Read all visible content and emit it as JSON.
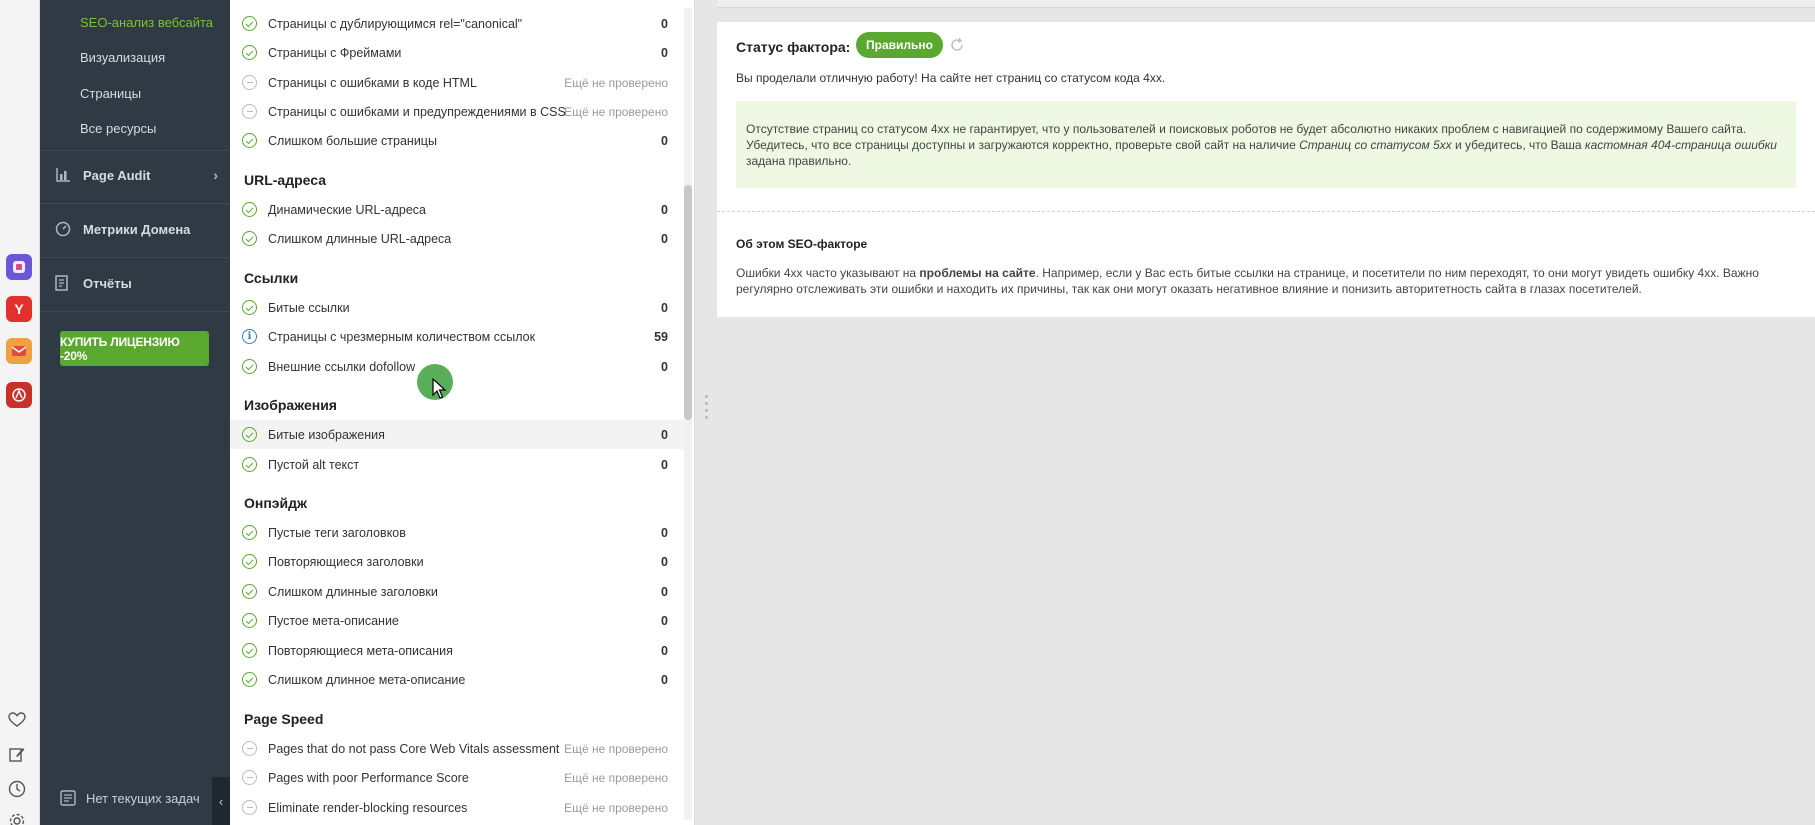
{
  "dock": {
    "apps": [
      {
        "icon": "figma-like-app-icon",
        "color": "#6b56d8"
      },
      {
        "icon": "yandex-browser-icon",
        "color": "#e2302d",
        "glyph": "Y"
      },
      {
        "icon": "mail-app-icon",
        "color": "#f0a040"
      },
      {
        "icon": "red-app-icon",
        "color": "#c8312a"
      }
    ]
  },
  "sidebar": {
    "sub_items": [
      "SEO-анализ вебсайта",
      "Визуализация",
      "Страницы",
      "Все ресурсы"
    ],
    "nav": {
      "page_audit": "Page Audit",
      "domain_metrics": "Метрики Домена",
      "reports": "Отчёты"
    },
    "buy_button": "КУПИТЬ ЛИЦЕНЗИЮ -20%",
    "tasks": "Нет текущих задач"
  },
  "factors": {
    "top_rows": [
      {
        "label": "Страницы с дублирующимся rel=\"canonical\"",
        "value": "0",
        "status": "ok"
      },
      {
        "label": "Страницы с Фреймами",
        "value": "0",
        "status": "ok"
      },
      {
        "label": "Страницы с ошибками в коде HTML",
        "value": "Ещё не проверено",
        "status": "na"
      },
      {
        "label": "Страницы с ошибками и предупреждениями в  CSS",
        "value": "Ещё не проверено",
        "status": "na"
      },
      {
        "label": "Слишком большие страницы",
        "value": "0",
        "status": "ok"
      }
    ],
    "url_title": "URL-адреса",
    "url_rows": [
      {
        "label": "Динамические URL-адреса",
        "value": "0",
        "status": "ok"
      },
      {
        "label": "Слишком длинные URL-адреса",
        "value": "0",
        "status": "ok"
      }
    ],
    "links_title": "Ссылки",
    "links_rows": [
      {
        "label": "Битые ссылки",
        "value": "0",
        "status": "ok"
      },
      {
        "label": "Страницы с чрезмерным количеством ссылок",
        "value": "59",
        "status": "info"
      },
      {
        "label": "Внешние ссылки dofollow",
        "value": "0",
        "status": "ok"
      }
    ],
    "images_title": "Изображения",
    "images_rows": [
      {
        "label": "Битые изображения",
        "value": "0",
        "status": "ok"
      },
      {
        "label": "Пустой alt текст",
        "value": "0",
        "status": "ok"
      }
    ],
    "onpage_title": "Онпэйдж",
    "onpage_rows": [
      {
        "label": "Пустые теги заголовков",
        "value": "0",
        "status": "ok"
      },
      {
        "label": "Повторяющиеся заголовки",
        "value": "0",
        "status": "ok"
      },
      {
        "label": "Слишком длинные заголовки",
        "value": "0",
        "status": "ok"
      },
      {
        "label": "Пустое мета-описание",
        "value": "0",
        "status": "ok"
      },
      {
        "label": "Повторяющиеся мета-описания",
        "value": "0",
        "status": "ok"
      },
      {
        "label": "Слишком длинное мета-описание",
        "value": "0",
        "status": "ok"
      }
    ],
    "speed_title": "Page Speed",
    "speed_rows": [
      {
        "label": "Pages that do not pass Core Web Vitals assessment",
        "value": "Ещё не проверено",
        "status": "na"
      },
      {
        "label": "Pages with poor Performance Score",
        "value": "Ещё не проверено",
        "status": "na"
      },
      {
        "label": "Eliminate render-blocking resources",
        "value": "Ещё не проверено",
        "status": "na"
      }
    ]
  },
  "detail": {
    "status_label": "Статус фактора:",
    "status_value": "Правильно",
    "summary": "Вы проделали отличную работу! На сайте нет страниц со статусом кода 4xx.",
    "note_part1": "Отсутствие страниц со статусом 4xx не гарантирует, что у пользователей и поисковых роботов не будет абсолютно никаких проблем с навигацией по содержимому Вашего сайта. Убедитесь, что все страницы доступны и загружаются корректно, проверьте свой сайт на наличие ",
    "note_link1": "Страниц со статусом 5xx",
    "note_part2": " и убедитесь, что Ваша ",
    "note_link2": "кастомная 404-страница ошибки",
    "note_part3": " задана правильно.",
    "about_title": "Об этом SEO-факторе",
    "about_part1": "Ошибки 4xx часто указывают на ",
    "about_bold": "проблемы на сайте",
    "about_part2": ". Например, если у Вас есть битые ссылки на странице, и посетители по ним переходят, то они могут увидеть ошибку 4xx. Важно регулярно отслеживать эти ошибки и находить их причины, так как они могут оказать негативное влияние и понизить авторитетность сайта в глазах посетителей."
  }
}
